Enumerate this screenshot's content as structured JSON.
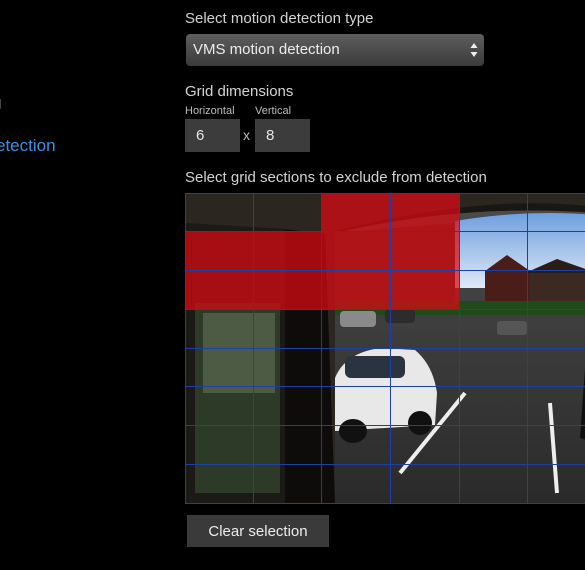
{
  "nav": {
    "item_above": "g",
    "active_item": "etection"
  },
  "motion_type": {
    "label": "Select motion detection type",
    "selected": "VMS motion detection"
  },
  "grid_dimensions": {
    "label": "Grid dimensions",
    "horizontal_label": "Horizontal",
    "vertical_label": "Vertical",
    "horizontal_value": "6",
    "vertical_value": "8",
    "separator": "x"
  },
  "exclusion": {
    "label": "Select grid sections to exclude from detection",
    "columns": 6,
    "rows": 8,
    "selected_cells": [
      [
        0,
        2
      ],
      [
        0,
        3
      ],
      [
        1,
        0
      ],
      [
        1,
        1
      ],
      [
        1,
        2
      ],
      [
        1,
        3
      ],
      [
        2,
        0
      ],
      [
        2,
        1
      ],
      [
        2,
        2
      ],
      [
        2,
        3
      ]
    ]
  },
  "actions": {
    "clear_label": "Clear selection"
  },
  "colors": {
    "accent": "#3d8fe0",
    "grid_line": "#1f3fa8",
    "selection": "#dc0a14"
  }
}
